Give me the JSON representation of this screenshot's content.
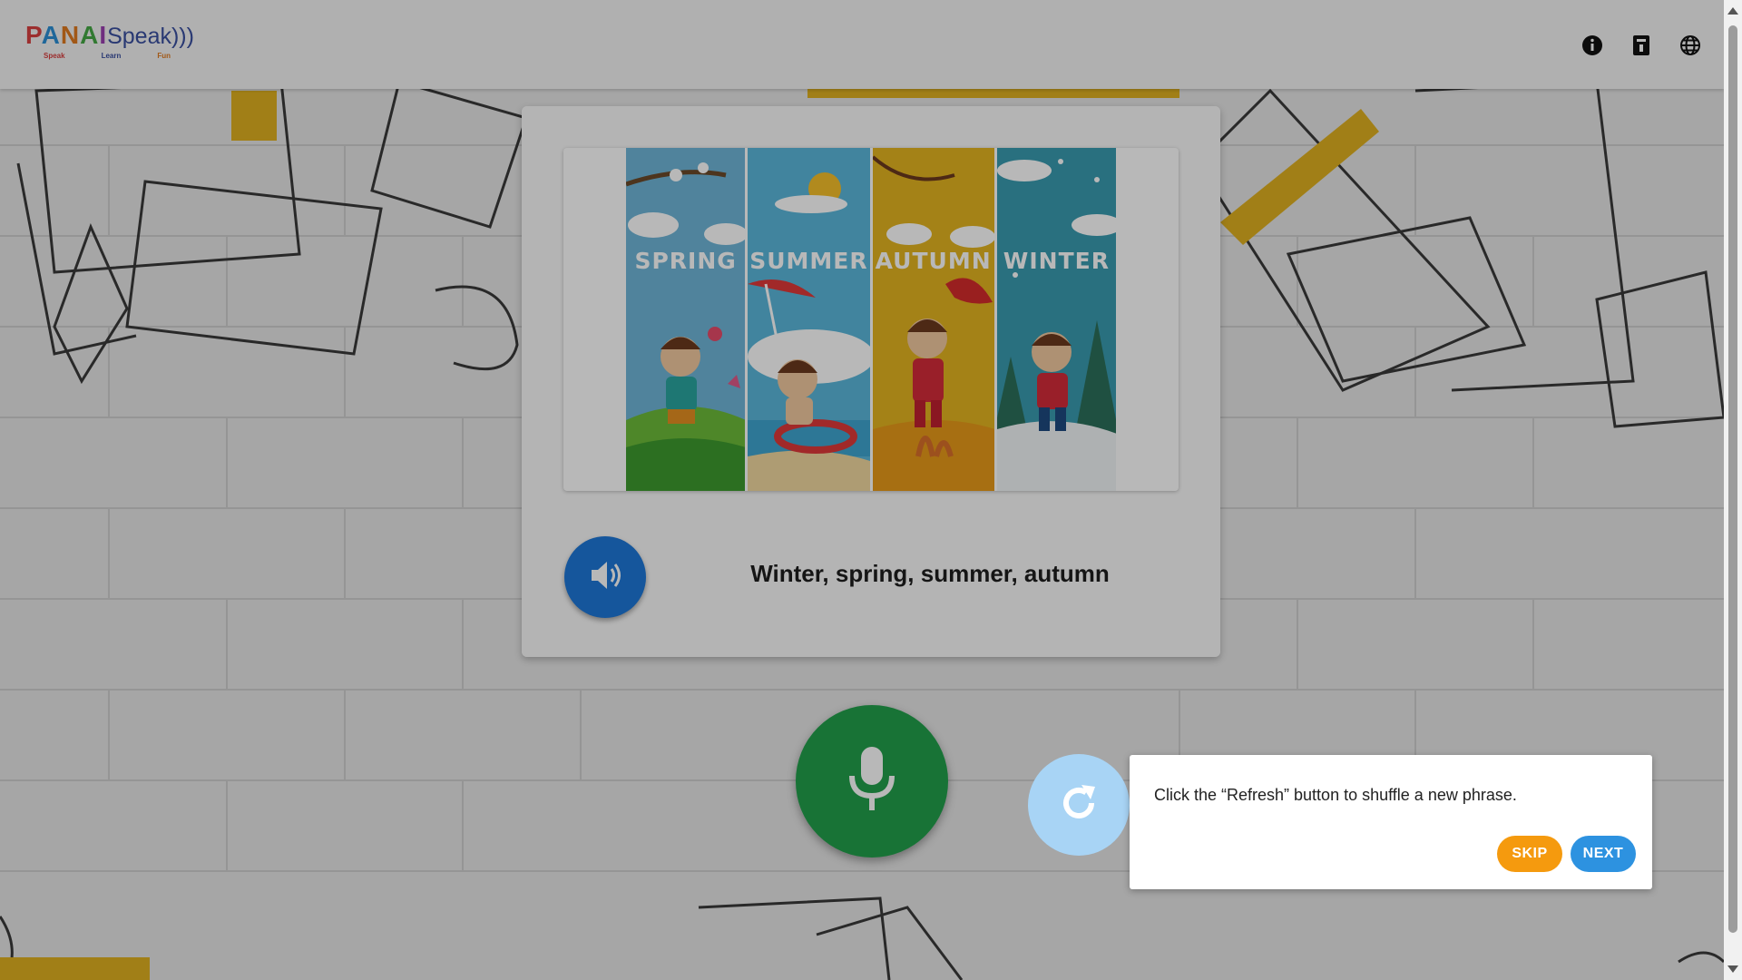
{
  "header": {
    "logo": {
      "letters": [
        "P",
        "A",
        "N",
        "A",
        "I"
      ],
      "speak": "Speak",
      "waves": ")))",
      "tags": [
        "Speak",
        "Learn",
        "Fun"
      ]
    },
    "icons": [
      "info-icon",
      "dictionary-icon",
      "globe-icon"
    ]
  },
  "card": {
    "image": {
      "panels": [
        {
          "label": "SPRING",
          "color": "#6fb6d8"
        },
        {
          "label": "SUMMER",
          "color": "#5ab8dc"
        },
        {
          "label": "AUTUMN",
          "color": "#e4b521"
        },
        {
          "label": "WINTER",
          "color": "#3a9bb0"
        }
      ]
    },
    "sound_icon": "speaker-icon",
    "phrase": "Winter, spring, summer, autumn"
  },
  "controls": {
    "mic_icon": "microphone-icon",
    "refresh_icon": "refresh-icon"
  },
  "tour": {
    "text": "Click the “Refresh” button to shuffle a new phrase.",
    "skip_label": "SKIP",
    "next_label": "NEXT"
  },
  "colors": {
    "mic": "#22a04c",
    "sound": "#1e78d8",
    "refresh": "#a8d4f5",
    "skip": "#f59a0e",
    "next": "#2d92e0"
  }
}
